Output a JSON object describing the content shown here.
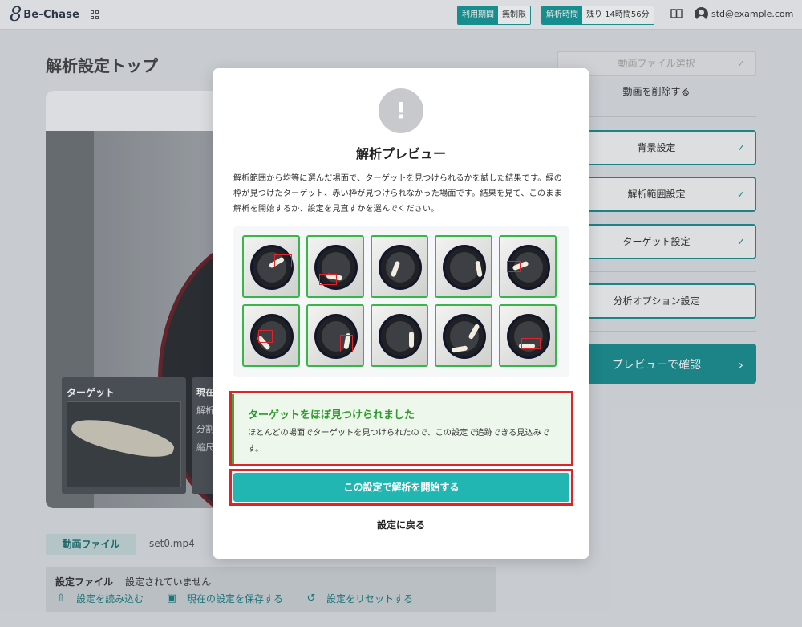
{
  "header": {
    "logo_mark": "8",
    "logo_text": "Be-Chase",
    "usage_period_label": "利用期間",
    "usage_period_value": "無制限",
    "analysis_time_label": "解析時間",
    "analysis_time_value": "残り 14時間56分",
    "user_email": "std@example.com",
    "icons": [
      "apps-grid-icon",
      "book-icon",
      "user-icon"
    ]
  },
  "page": {
    "title": "解析設定トップ",
    "target_panel_label": "ターゲット",
    "info_panel_lines": [
      "現在",
      "解析",
      "分割",
      "縮尺"
    ]
  },
  "right_panel": {
    "select_video": "動画ファイル選択",
    "delete_video": "動画を削除する",
    "background_setting": "背景設定",
    "range_setting": "解析範囲設定",
    "target_setting": "ターゲット設定",
    "option_setting": "分析オプション設定",
    "preview_button": "プレビューで確認",
    "check_mark": "✓",
    "chevron": "›"
  },
  "footer": {
    "video_file_label": "動画ファイル",
    "video_file_name": "set0.mp4",
    "settings_file_label": "設定ファイル",
    "settings_file_value": "設定されていません",
    "load_settings": "設定を読み込む",
    "save_settings": "現在の設定を保存する",
    "reset_settings": "設定をリセットする"
  },
  "modal": {
    "icon_glyph": "!",
    "title": "解析プレビュー",
    "description": "解析範囲から均等に選んだ場面で、ターゲットを見つけられるかを試した結果です。緑の枠が見つけたターゲット、赤い枠が見つけられなかった場面です。結果を見て、このまま解析を開始するか、設定を見直すかを選んでください。",
    "frame_count": 10,
    "frames_found": 10,
    "result_title": "ターゲットをほぼ見つけられました",
    "result_text": "ほとんどの場面でターゲットを見つけられたので、この設定で追跡できる見込みです。",
    "start_button": "この設定で解析を開始する",
    "back_link": "設定に戻る"
  },
  "colors": {
    "accent": "#1b8f91",
    "start_button": "#22b6b3",
    "found_border": "#39b54a",
    "highlight": "#e22228",
    "success_text": "#2f9a2c"
  }
}
